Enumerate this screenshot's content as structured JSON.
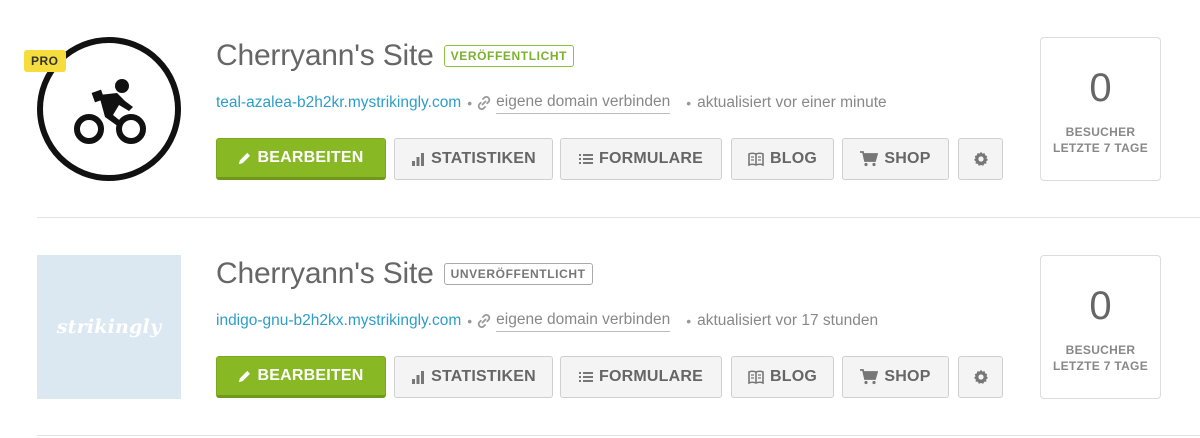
{
  "sites": [
    {
      "badge": "PRO",
      "title": "Cherryann's Site",
      "status": "VERÖFFENTLICHT",
      "url": "teal-azalea-b2h2kr.mystrikingly.com",
      "connect_domain": "eigene domain verbinden",
      "updated": "aktualisiert vor einer minute",
      "buttons": {
        "edit": "BEARBEITEN",
        "stats": "STATISTIKEN",
        "forms": "FORMULARE",
        "blog": "BLOG",
        "shop": "SHOP"
      },
      "visitors": {
        "count": "0",
        "label_line1": "BESUCHER",
        "label_line2": "LETZTE 7 TAGE"
      }
    },
    {
      "logo_text": "strikingly",
      "title": "Cherryann's Site",
      "status": "UNVERÖFFENTLICHT",
      "url": "indigo-gnu-b2h2kx.mystrikingly.com",
      "connect_domain": "eigene domain verbinden",
      "updated": "aktualisiert vor 17 stunden",
      "buttons": {
        "edit": "BEARBEITEN",
        "stats": "STATISTIKEN",
        "forms": "FORMULARE",
        "blog": "BLOG",
        "shop": "SHOP"
      },
      "visitors": {
        "count": "0",
        "label_line1": "BESUCHER",
        "label_line2": "LETZTE 7 TAGE"
      }
    }
  ],
  "colors": {
    "accent_green": "#88b924",
    "link_blue": "#2c9ec9",
    "pro_yellow": "#f4dd3d",
    "published_green": "#7bb12e"
  },
  "icons": [
    "bicycle-rider-icon",
    "pencil-icon",
    "bar-chart-icon",
    "list-icon",
    "book-icon",
    "cart-icon",
    "gear-icon",
    "link-icon"
  ]
}
